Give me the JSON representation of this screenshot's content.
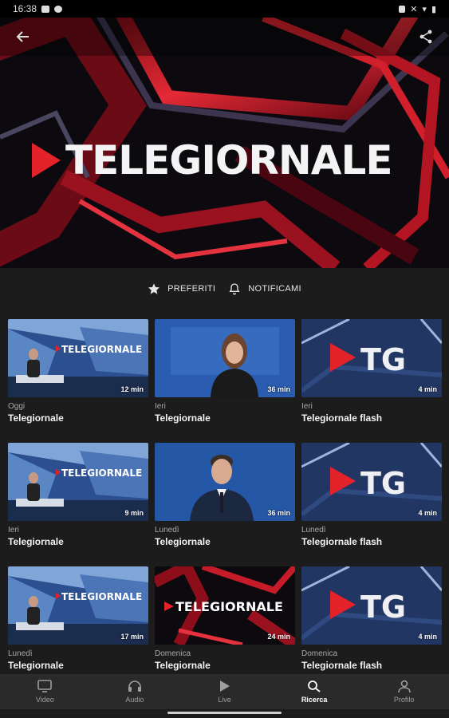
{
  "status": {
    "time": "16:38",
    "battery": "61%"
  },
  "icons": {
    "back": "arrow-left-icon",
    "share": "share-icon",
    "favorite": "star-icon",
    "notify": "bell-icon"
  },
  "hero": {
    "title": "TELEGIORNALE"
  },
  "actions": {
    "favorites": "PREFERITI",
    "notify": "NOTIFICAMI"
  },
  "videos": [
    {
      "date": "Oggi",
      "title": "Telegiornale",
      "duration": "12 min",
      "thumb": "studio"
    },
    {
      "date": "Ieri",
      "title": "Telegiornale",
      "duration": "36 min",
      "thumb": "anchor-woman"
    },
    {
      "date": "Ieri",
      "title": "Telegiornale flash",
      "duration": "4 min",
      "thumb": "tg"
    },
    {
      "date": "Ieri",
      "title": "Telegiornale",
      "duration": "9 min",
      "thumb": "studio"
    },
    {
      "date": "Lunedì",
      "title": "Telegiornale",
      "duration": "36 min",
      "thumb": "anchor-man"
    },
    {
      "date": "Lunedì",
      "title": "Telegiornale flash",
      "duration": "4 min",
      "thumb": "tg"
    },
    {
      "date": "Lunedì",
      "title": "Telegiornale",
      "duration": "17 min",
      "thumb": "studio"
    },
    {
      "date": "Domenica",
      "title": "Telegiornale",
      "duration": "24 min",
      "thumb": "red-logo"
    },
    {
      "date": "Domenica",
      "title": "Telegiornale flash",
      "duration": "4 min",
      "thumb": "tg"
    }
  ],
  "thumb_texts": {
    "studio": "TELEGIORNALE",
    "red": "TELEGIORNALE",
    "tg": "TG"
  },
  "nav": [
    {
      "label": "Video",
      "icon": "tv-icon",
      "active": false
    },
    {
      "label": "Audio",
      "icon": "headphones-icon",
      "active": false
    },
    {
      "label": "Live",
      "icon": "play-icon",
      "active": false
    },
    {
      "label": "Ricerca",
      "icon": "search-icon",
      "active": true
    },
    {
      "label": "Profilo",
      "icon": "profile-icon",
      "active": false
    }
  ],
  "colors": {
    "accent": "#e4222a",
    "background": "#1c1c1c",
    "nav_bg": "#2a2a2a"
  }
}
